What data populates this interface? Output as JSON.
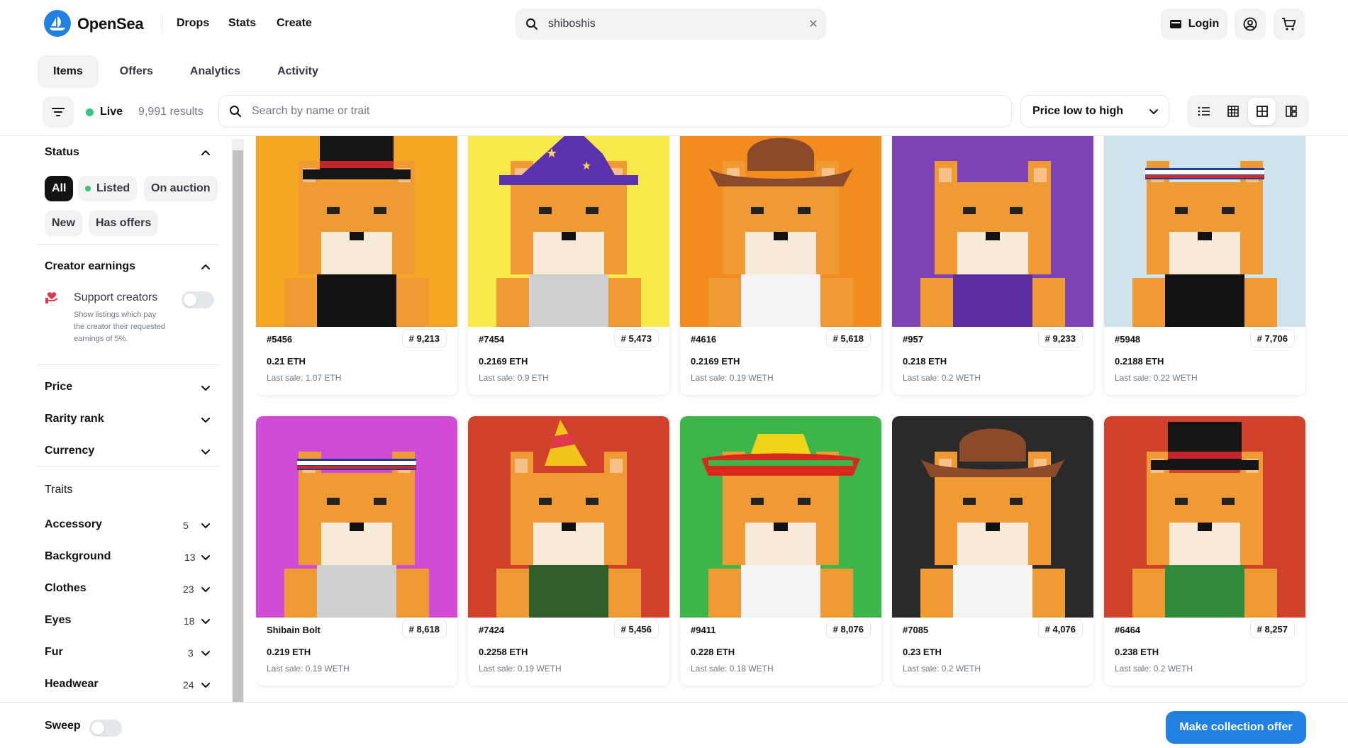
{
  "brand": {
    "name": "OpenSea",
    "accent": "#2081e2"
  },
  "nav": {
    "links": [
      "Drops",
      "Stats",
      "Create"
    ]
  },
  "search": {
    "value": "shiboshis",
    "clear_icon": "close-icon"
  },
  "header": {
    "login_label": "Login"
  },
  "tabs": [
    "Items",
    "Offers",
    "Analytics",
    "Activity"
  ],
  "toolbar": {
    "live_label": "Live",
    "results": "9,991 results",
    "trait_search_placeholder": "Search by name or trait",
    "sort_value": "Price low to high"
  },
  "sidebar": {
    "status": {
      "title": "Status",
      "options": [
        "All",
        "Listed",
        "On auction",
        "New",
        "Has offers"
      ]
    },
    "creator_earnings": {
      "title": "Creator earnings",
      "support_label": "Support creators",
      "support_desc": "Show listings which pay the creator their requested earnings of 5%."
    },
    "filters": [
      "Price",
      "Rarity rank",
      "Currency"
    ],
    "traits_title": "Traits",
    "traits": [
      {
        "name": "Accessory",
        "count": "5"
      },
      {
        "name": "Background",
        "count": "13"
      },
      {
        "name": "Clothes",
        "count": "23"
      },
      {
        "name": "Eyes",
        "count": "18"
      },
      {
        "name": "Fur",
        "count": "3"
      },
      {
        "name": "Headwear",
        "count": "24"
      }
    ]
  },
  "items": [
    {
      "name": "#5456",
      "rank": "# 9,213",
      "price": "0.21 ETH",
      "last": "Last sale: 1.07 ETH",
      "bg": "#f5a623",
      "hat": "tophat",
      "body": "#111111"
    },
    {
      "name": "#7454",
      "rank": "# 5,473",
      "price": "0.2169 ETH",
      "last": "Last sale: 0.9 ETH",
      "bg": "#f7e94a",
      "hat": "wizard",
      "body": "#cfcfcf"
    },
    {
      "name": "#4616",
      "rank": "# 5,618",
      "price": "0.2169 ETH",
      "last": "Last sale: 0.19 WETH",
      "bg": "#f28c1e",
      "hat": "cowboy",
      "body": "#f4f4f4"
    },
    {
      "name": "#957",
      "rank": "# 9,233",
      "price": "0.218 ETH",
      "last": "Last sale: 0.2 WETH",
      "bg": "#7d43b7",
      "hat": "none",
      "body": "#5b2d9e"
    },
    {
      "name": "#5948",
      "rank": "# 7,706",
      "price": "0.2188 ETH",
      "last": "Last sale: 0.22 WETH",
      "bg": "#cfe3ec",
      "hat": "band",
      "body": "#111111"
    },
    {
      "name": "Shibain Bolt",
      "rank": "# 8,618",
      "price": "0.219 ETH",
      "last": "Last sale: 0.19 WETH",
      "bg": "#d14bd6",
      "hat": "band",
      "body": "#cfcfcf"
    },
    {
      "name": "#7424",
      "rank": "# 5,456",
      "price": "0.2258 ETH",
      "last": "Last sale: 0.19 WETH",
      "bg": "#d0402a",
      "hat": "party",
      "body": "#2f5e2a"
    },
    {
      "name": "#9411",
      "rank": "# 8,076",
      "price": "0.228 ETH",
      "last": "Last sale: 0.18 WETH",
      "bg": "#3cb54a",
      "hat": "sombrero",
      "body": "#f4f4f4"
    },
    {
      "name": "#7085",
      "rank": "# 4,076",
      "price": "0.23 ETH",
      "last": "Last sale: 0.2 WETH",
      "bg": "#2a2a2a",
      "hat": "cowboy",
      "body": "#f4f4f4"
    },
    {
      "name": "#6464",
      "rank": "# 8,257",
      "price": "0.238 ETH",
      "last": "Last sale: 0.2 WETH",
      "bg": "#d0402a",
      "hat": "tophat",
      "body": "#2f8a3a"
    }
  ],
  "footer": {
    "sweep_label": "Sweep",
    "offer_button": "Make collection offer"
  }
}
